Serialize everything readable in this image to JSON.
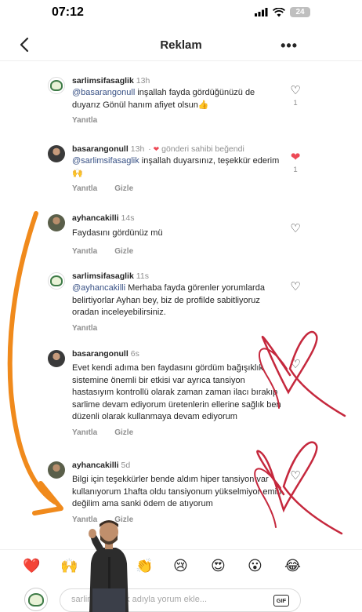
{
  "status": {
    "time": "07:12",
    "battery": "24"
  },
  "nav": {
    "title": "Reklam"
  },
  "comments": [
    {
      "username": "sarlimsifasaglik",
      "time": "13h",
      "mention": "@basarangonull",
      "text": " inşallah fayda gördüğünüzü de duyarız Gönül hanım afiyet olsun👍",
      "reply": "Yanıtla",
      "likes": "1"
    },
    {
      "username": "basarangonull",
      "time": "13h",
      "liked_by_author": "gönderi sahibi beğendi",
      "mention": "@sarlimsifasaglik",
      "text": " inşallah duyarsınız, teşekkür ederim 🙌",
      "reply": "Yanıtla",
      "hide": "Gizle",
      "likes": "1"
    },
    {
      "username": "ayhancakilli",
      "time": "14s",
      "text": "Faydasını gördünüz mü",
      "reply": "Yanıtla",
      "hide": "Gizle"
    },
    {
      "username": "sarlimsifasaglik",
      "time": "11s",
      "mention": "@ayhancakilli",
      "text": " Merhaba fayda görenler yorumlarda belirtiyorlar Ayhan bey, biz de profilde sabitliyoruz oradan inceleyebilirsiniz.",
      "reply": "Yanıtla"
    },
    {
      "username": "basarangonull",
      "time": "6s",
      "text": "Evet kendi adıma ben faydasını gördüm bağışıklık sistemine önemli bir etkisi var ayrıca tansiyon hastasıyım kontrollü olarak zaman zaman ilacı bırakıp sarlime devam ediyorum üretenlerin ellerine sağlık ben düzenli olarak kullanmaya devam ediyorum",
      "reply": "Yanıtla",
      "hide": "Gizle"
    },
    {
      "username": "ayhancakilli",
      "time": "5d",
      "text": "Bilgi için teşekkürler bende aldım hiper tansiyon var kullanıyorum 1hafta oldu tansiyonum yükselmiyor emin değilim ama sanki ödem de atıyorum",
      "reply": "Yanıtla",
      "hide": "Gizle"
    }
  ],
  "emojis": [
    "❤️",
    "🙌",
    "🔥",
    "👏",
    "😢",
    "😍",
    "😮",
    "😂"
  ],
  "composer": {
    "placeholder": "sarlimsifasaglik adıyla yorum ekle...",
    "gif": "GIF"
  },
  "colors": {
    "mention": "#385185",
    "like_red": "#ed4956",
    "annotation_orange": "#f08a1c",
    "annotation_red": "#c5283d"
  },
  "icons": {
    "back": "chevron-left-icon",
    "more": "more-horizontal-icon",
    "like": "heart-icon"
  }
}
